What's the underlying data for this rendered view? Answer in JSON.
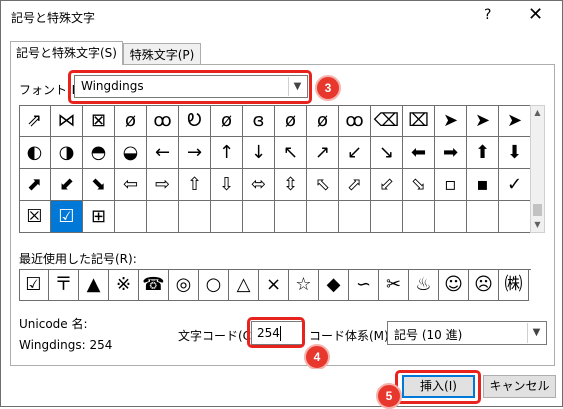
{
  "window": {
    "title": "記号と特殊文字",
    "help_label": "?",
    "close_label": "✕"
  },
  "tabs": [
    {
      "label": "記号と特殊文字(S)"
    },
    {
      "label": "特殊文字(P)"
    }
  ],
  "font": {
    "label": "フォント(F):",
    "value": "Wingdings"
  },
  "symbol_grid": {
    "rows": [
      [
        "⇗",
        "⋈",
        "⊠",
        "ø",
        "ꝏ",
        "Ꭷ",
        "ø",
        "ɞ",
        "ø",
        "ø",
        "ꝏ",
        "⌫",
        "⌧",
        "➤",
        "➤",
        "➤"
      ],
      [
        "◐",
        "◑",
        "◓",
        "◒",
        "←",
        "→",
        "↑",
        "↓",
        "↖",
        "↗",
        "↙",
        "↘",
        "⬅",
        "➡",
        "⬆",
        "⬇"
      ],
      [
        "⬈",
        "⬋",
        "⬊",
        "⇦",
        "⇨",
        "⇧",
        "⇩",
        "⬄",
        "⇳",
        "⬁",
        "⬀",
        "⬃",
        "⬂",
        "▫",
        "▪",
        "✗"
      ],
      [
        "☒",
        "☑",
        "⊞",
        "",
        "",
        "",
        "",
        "",
        "",
        "",
        "",
        "",
        "",
        "",
        "",
        ""
      ]
    ],
    "row3_last": "✓",
    "selected": {
      "row": 3,
      "col": 1
    }
  },
  "recent": {
    "label": "最近使用した記号(R):",
    "symbols": [
      "☑",
      "〒",
      "▲",
      "※",
      "☎",
      "◎",
      "○",
      "△",
      "×",
      "☆",
      "◆",
      "∽",
      "✂",
      "♨",
      "☺",
      "☹",
      "㈱"
    ]
  },
  "info": {
    "unicode_label": "Unicode 名:",
    "description": "Wingdings: 254"
  },
  "code": {
    "label": "文字コード(C):",
    "value": "254",
    "system_label": "コード体系(M):",
    "system_value": "記号 (10 進)"
  },
  "buttons": {
    "insert": "挿入(I)",
    "cancel": "キャンセル"
  },
  "callouts": {
    "three": "3",
    "four": "4",
    "five": "5"
  },
  "colors": {
    "highlight": "#e8231e",
    "selection": "#0078d7",
    "badge": "#e8372d"
  }
}
